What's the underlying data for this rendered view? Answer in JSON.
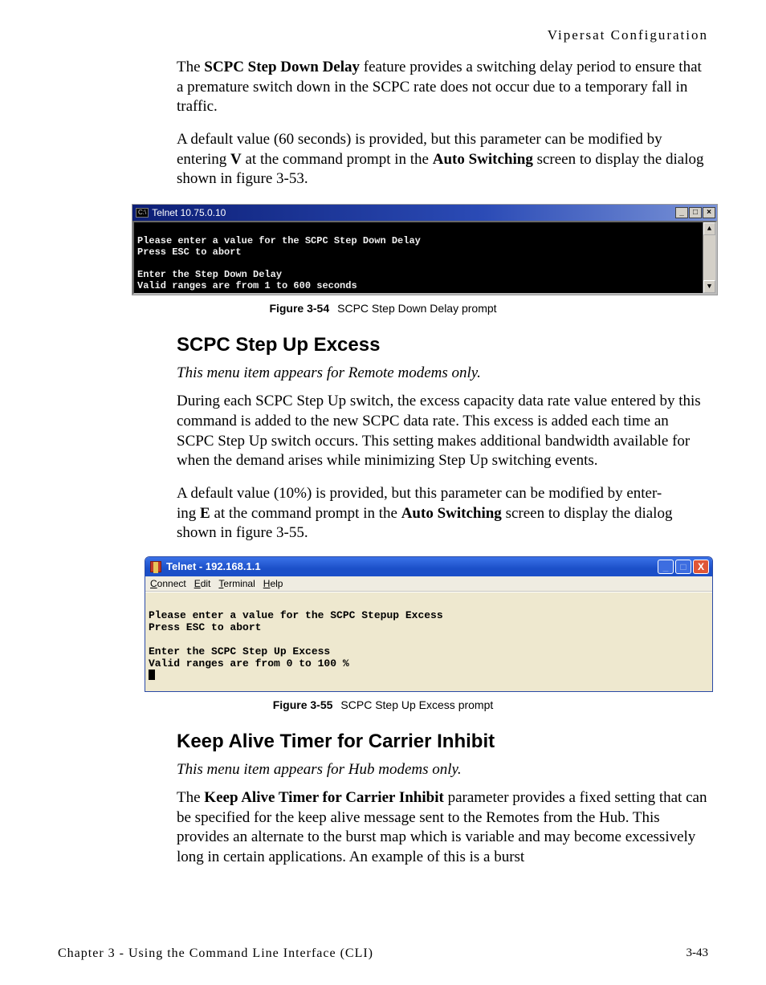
{
  "header": {
    "right": "Vipersat Configuration"
  },
  "para1_a": "The ",
  "para1_bold": "SCPC Step Down Delay",
  "para1_b": " feature provides a switching delay period to ensure that a premature switch down in the SCPC rate does not occur due to a temporary fall in traffic.",
  "para2_a": "A default value (60 seconds) is provided, but this parameter can be modified by entering ",
  "para2_b": "V",
  "para2_c": " at the command prompt in the ",
  "para2_d": "Auto Switching",
  "para2_e": " screen to display the dialog shown in figure 3-53.",
  "fig1": {
    "icon_text": "C:\\",
    "title": "Telnet 10.75.0.10",
    "min": "_",
    "max": "□",
    "close": "×",
    "scroll_up": "▲",
    "scroll_dn": "▼",
    "term": "\nPlease enter a value for the SCPC Step Down Delay\nPress ESC to abort\n\nEnter the Step Down Delay\nValid ranges are from 1 to 600 seconds\n",
    "caption_label": "Figure 3-54",
    "caption_text": "SCPC Step Down Delay prompt"
  },
  "sec1_heading": "SCPC Step Up Excess",
  "sec1_note": "This menu item appears for Remote modems only.",
  "sec1_p1": "During each SCPC Step Up switch, the excess capacity data rate value entered by this command is added to the new SCPC data rate. This excess is added each time an SCPC Step Up switch occurs. This setting makes additional bandwidth available for when the demand arises while minimizing Step Up switching events.",
  "sec1_p2_a": "A default value (10%) is provided, but this parameter can be modified by enter-",
  "sec1_p2_b": "ing ",
  "sec1_p2_c": "E",
  "sec1_p2_d": " at the command prompt in the ",
  "sec1_p2_e": "Auto Switching",
  "sec1_p2_f": " screen to display the dialog shown in figure 3-55.",
  "fig2": {
    "title": "Telnet - 192.168.1.1",
    "min": "_",
    "max": "□",
    "close": "X",
    "menu": {
      "connect": "Connect",
      "edit": "Edit",
      "terminal": "Terminal",
      "help": "Help"
    },
    "term": "\nPlease enter a value for the SCPC Stepup Excess\nPress ESC to abort\n\nEnter the SCPC Step Up Excess\nValid ranges are from 0 to 100 %\n",
    "caption_label": "Figure 3-55",
    "caption_text": "SCPC Step Up Excess prompt"
  },
  "sec2_heading": "Keep Alive Timer for Carrier Inhibit",
  "sec2_note": "This menu item appears for Hub modems only.",
  "sec2_p1_a": "The ",
  "sec2_p1_b": "Keep Alive Timer for Carrier Inhibit",
  "sec2_p1_c": " parameter provides a fixed setting that can be specified for the keep alive message sent to the Remotes from the Hub. This provides an alternate to the burst map which is variable and may become excessively long in certain applications. An example of this is a burst",
  "footer": {
    "left": "Chapter 3 - Using the Command Line Interface (CLI)",
    "right": "3-43"
  }
}
